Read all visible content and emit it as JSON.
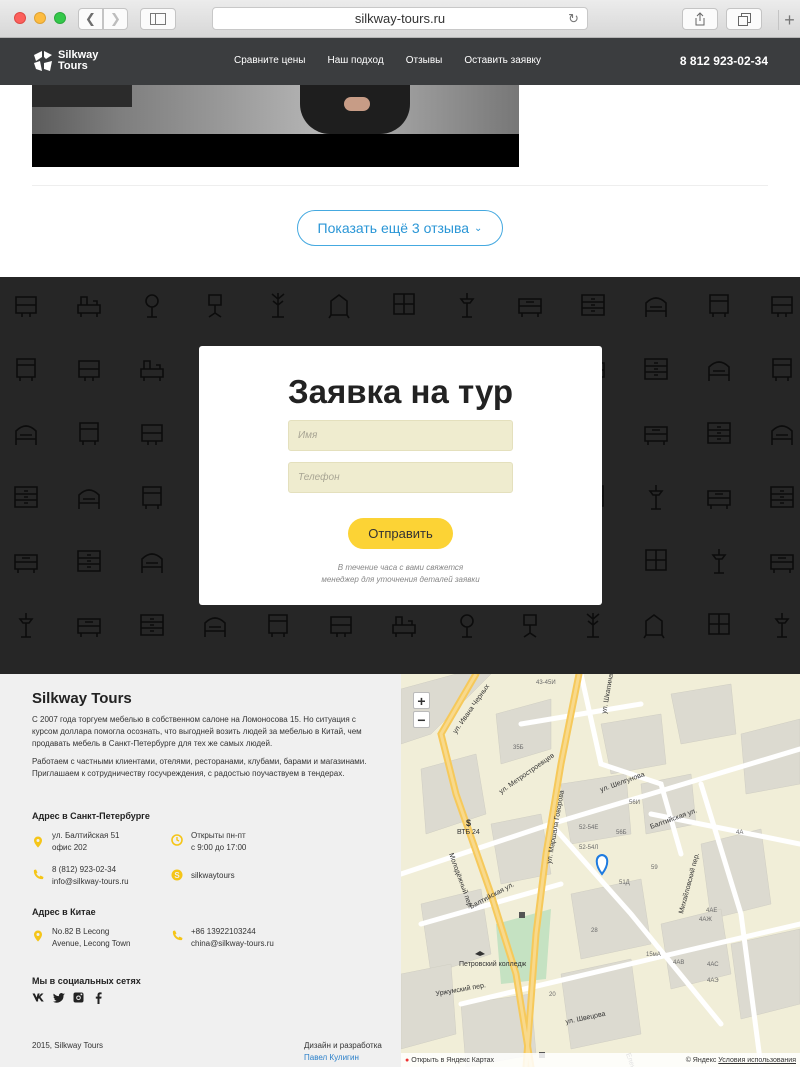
{
  "browser": {
    "url": "silkway-tours.ru"
  },
  "header": {
    "logo_line1": "Silkway",
    "logo_line2": "Tours",
    "menu": [
      "Сравните цены",
      "Наш подход",
      "Отзывы",
      "Оставить заявку"
    ],
    "phone": "8 812 923-02-34"
  },
  "reviews": {
    "more_button": "Показать ещё 3 отзыва"
  },
  "form": {
    "title": "Заявка на тур",
    "name_placeholder": "Имя",
    "phone_placeholder": "Телефон",
    "submit_label": "Отправить",
    "note_line1": "В течение часа с вами свяжется",
    "note_line2": "менеджер для уточнения деталей заявки"
  },
  "footer": {
    "title": "Silkway Tours",
    "paragraph1": "С 2007 года торгуем мебелью в собственном салоне на Ломоносова 15. Но ситуация с курсом доллара помогла осознать, что выгодней возить людей за мебелью в Китай, чем продавать мебель в Санкт-Петербурге для тех же самых людей.",
    "paragraph2": "Работаем с частными клиентами, отелями, ресторанами, клубами, барами и магазинами. Приглашаем к сотрудничеству госучреждения, с радостью поучаствуем в тендерах.",
    "spb_heading": "Адрес в Санкт-Петербурге",
    "spb_address_line1": "ул. Балтийская 51",
    "spb_address_line2": "офис 202",
    "spb_hours_line1": "Открыты пн-пт",
    "spb_hours_line2": "с 9:00 до 17:00",
    "spb_phone": "8 (812) 923-02-34",
    "spb_email": "info@silkway-tours.ru",
    "skype": "silkwaytours",
    "china_heading": "Адрес в Китае",
    "china_address_line1": "No.82 B Lecong",
    "china_address_line2": "Avenue, Lecong Town",
    "china_phone": "+86 13922103244",
    "china_email": "china@silkway-tours.ru",
    "social_heading": "Мы в социальных сетях",
    "social_icons": [
      "vk-icon",
      "twitter-icon",
      "instagram-icon",
      "facebook-icon"
    ],
    "copyright": "2015, Silkway Tours",
    "design_label": "Дизайн и разработка",
    "design_author": "Павел Кулигин"
  },
  "map": {
    "zoom_in": "+",
    "zoom_out": "−",
    "open_label": "Открыть в Яндекс Картах",
    "copyright": "© Яндекс",
    "terms": "Условия использования",
    "streets": [
      "ул. Ивана Черных",
      "ул. Метростроевцев",
      "ул. Маршала Говорова",
      "Балтийская ул.",
      "ул. Швецова",
      "Михайловский пер.",
      "Уржумский пер.",
      "Молодёжный пер.",
      "ул. Шкапина",
      "ул. Шелгунова",
      "Еленинская ул.",
      "Петровский колледж",
      "ВТБ 24"
    ],
    "buildings": [
      "35Б",
      "43-45И",
      "4А",
      "4АЕ",
      "4АЖ",
      "4АВ",
      "4АС",
      "4АЭ",
      "15мА",
      "59",
      "51Д",
      "56Б",
      "52-54Е",
      "52-54Л",
      "56И",
      "28",
      "20"
    ]
  },
  "colors": {
    "header_bg": "#3b3d3f",
    "accent_yellow": "#fcd335",
    "link_blue": "#2a96d6",
    "pattern_bg": "#262626",
    "field_bg": "#efeccf"
  }
}
